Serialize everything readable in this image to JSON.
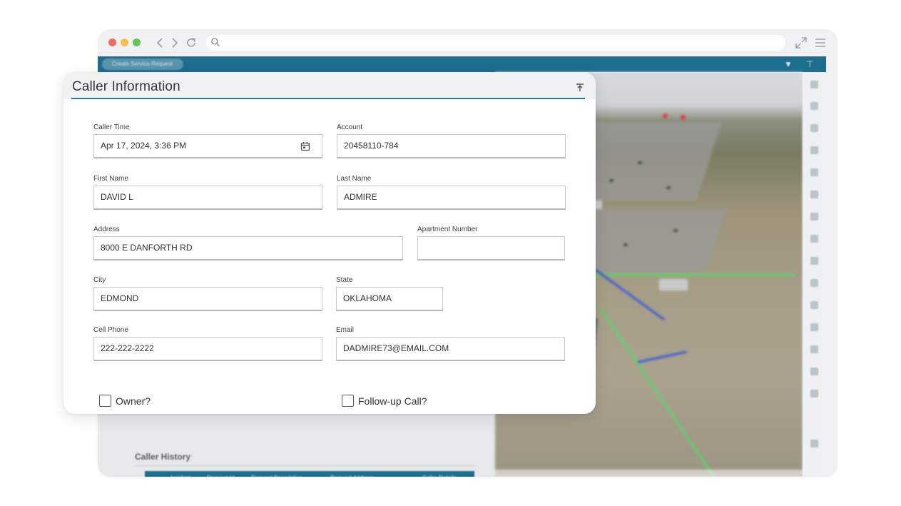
{
  "card": {
    "title": "Caller Information",
    "fields": {
      "caller_time": {
        "label": "Caller Time",
        "value": "Apr 17, 2024, 3:36 PM"
      },
      "account": {
        "label": "Account",
        "value": "20458110-784"
      },
      "first_name": {
        "label": "First Name",
        "value": "DAVID L"
      },
      "last_name": {
        "label": "Last Name",
        "value": "ADMIRE"
      },
      "address": {
        "label": "Address",
        "value": "8000 E DANFORTH RD"
      },
      "apartment": {
        "label": "Apartment Number",
        "value": ""
      },
      "city": {
        "label": "City",
        "value": "EDMOND"
      },
      "state": {
        "label": "State",
        "value": "OKLAHOMA"
      },
      "cell_phone": {
        "label": "Cell Phone",
        "value": "222-222-2222"
      },
      "email": {
        "label": "Email",
        "value": "DADMIRE73@EMAIL.COM"
      }
    },
    "checkboxes": {
      "owner": {
        "label": "Owner?",
        "checked": false
      },
      "follow_up": {
        "label": "Follow-up Call?",
        "checked": false
      }
    }
  },
  "background": {
    "create_button": "Create Service Request",
    "history": {
      "title": "Caller History",
      "columns": [
        "Incident",
        "Request Id",
        "Request Description",
        "Request Address",
        "Caller Details"
      ]
    }
  },
  "colors": {
    "accent_teal": "#2a7d8b",
    "app_header_blue": "#1d6d8e",
    "traffic_red": "#ee6a5f",
    "traffic_yellow": "#f5be4f",
    "traffic_green": "#62c555"
  },
  "icons": {
    "calendar": "calendar-icon",
    "collapse": "collapse-up-icon",
    "search": "search-icon",
    "expand": "expand-icon",
    "menu": "menu-icon"
  }
}
